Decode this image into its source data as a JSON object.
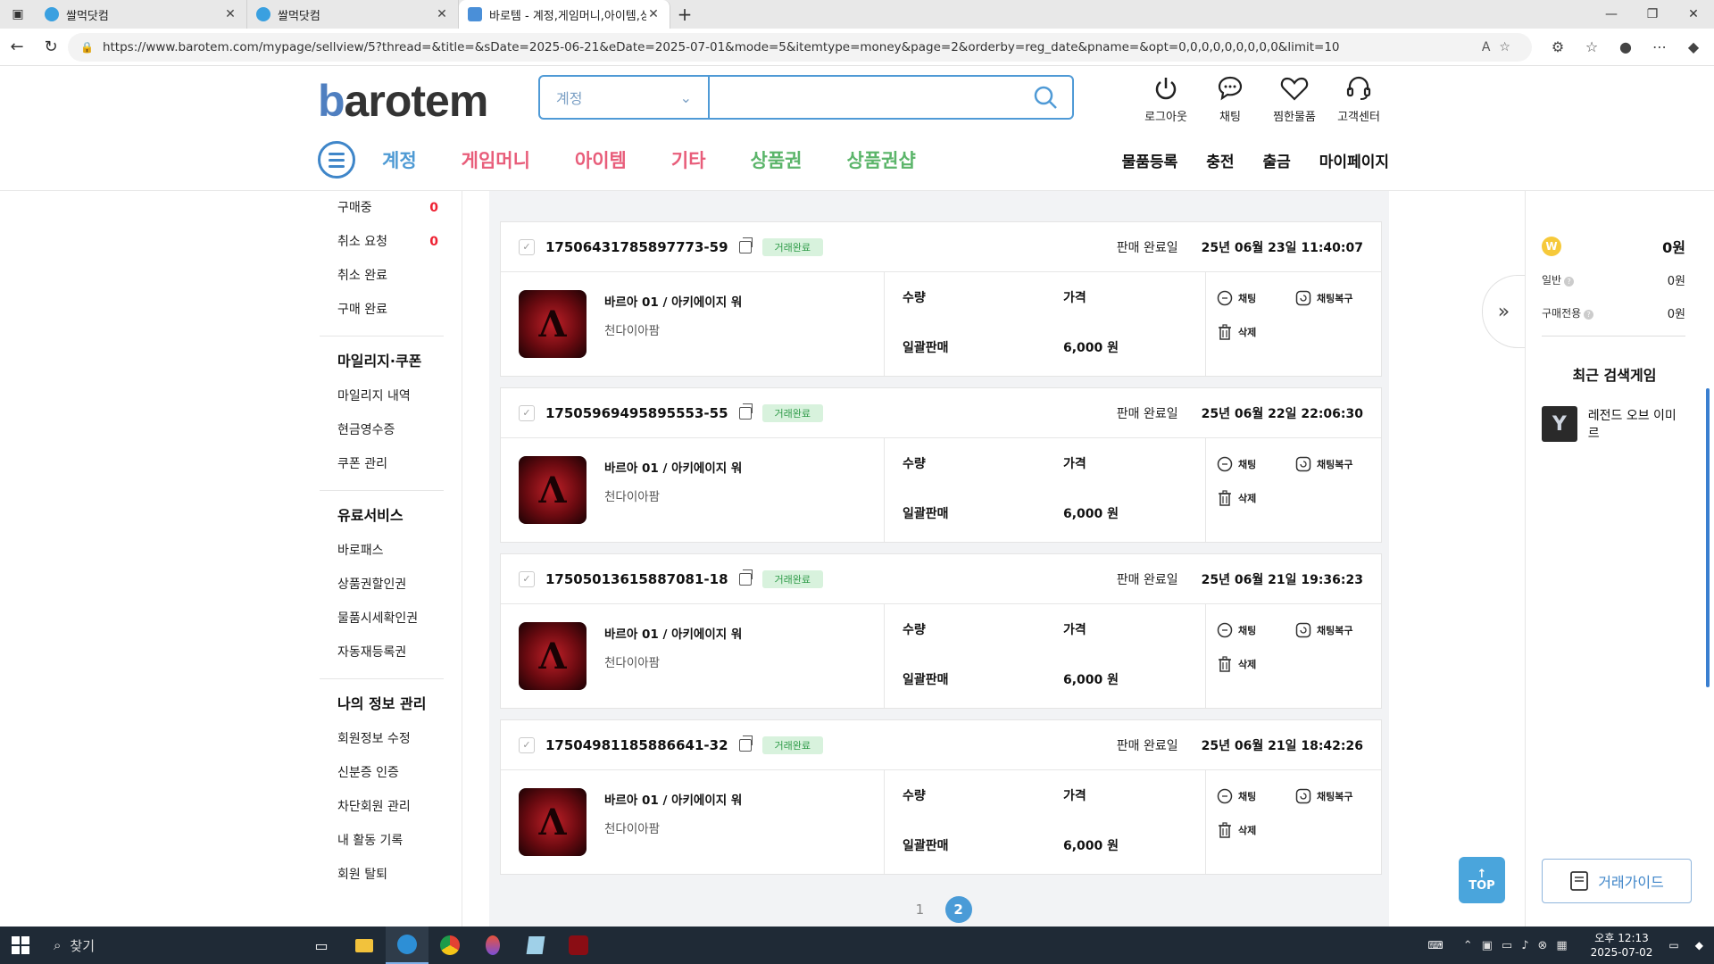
{
  "browser": {
    "tabs": [
      {
        "title": "쌀먹닷컴"
      },
      {
        "title": "쌀먹닷컴"
      },
      {
        "title": "바로템 - 계정,게임머니,아이템,상"
      }
    ],
    "url": "https://www.barotem.com/mypage/sellview/5?thread=&title=&sDate=2025-06-21&eDate=2025-07-01&mode=5&itemtype=money&page=2&orderby=reg_date&pname=&opt=0,0,0,0,0,0,0,0,0&limit=10"
  },
  "header": {
    "logo_b": "b",
    "logo_rest": "arotem",
    "search_category": "계정",
    "search_value": "",
    "icons": [
      {
        "label": "로그아웃"
      },
      {
        "label": "채팅"
      },
      {
        "label": "찜한물품"
      },
      {
        "label": "고객센터"
      }
    ]
  },
  "gnb": {
    "categories": [
      {
        "label": "계정",
        "color": "#4e9ad4"
      },
      {
        "label": "게임머니",
        "color": "#e85d7a"
      },
      {
        "label": "아이템",
        "color": "#e85d7a"
      },
      {
        "label": "기타",
        "color": "#e85d7a"
      },
      {
        "label": "상품권",
        "color": "#5bb56a"
      },
      {
        "label": "상품권샵",
        "color": "#5bb56a"
      }
    ],
    "right": [
      "물품등록",
      "충전",
      "출금",
      "마이페이지"
    ]
  },
  "sidebar": {
    "group1": [
      {
        "label": "구매중",
        "count": "0"
      },
      {
        "label": "취소 요청",
        "count": "0"
      },
      {
        "label": "취소 완료",
        "count": ""
      },
      {
        "label": "구매 완료",
        "count": ""
      }
    ],
    "group2": {
      "title": "마일리지·쿠폰",
      "items": [
        "마일리지 내역",
        "현금영수증",
        "쿠폰 관리"
      ]
    },
    "group3": {
      "title": "유료서비스",
      "items": [
        "바로패스",
        "상품권할인권",
        "물품시세확인권",
        "자동재등록권"
      ]
    },
    "group4": {
      "title": "나의 정보 관리",
      "items": [
        "회원정보 수정",
        "신분증 인증",
        "차단회원 관리",
        "내 활동 기록",
        "회원 탈퇴"
      ]
    }
  },
  "orders": [
    {
      "no": "17506431785897773-59",
      "badge": "거래완료",
      "done_label": "판매 완료일",
      "done_date": "25년 06월 23일 11:40:07",
      "title": "바르아 01 / 아키에이지 워",
      "sub": "천다이아팜",
      "qty_label": "수량",
      "price_label": "가격",
      "qty": "일괄판매",
      "price": "6,000 원",
      "chat": "채팅",
      "restore": "채팅복구",
      "delete": "삭제"
    },
    {
      "no": "17505969495895553-55",
      "badge": "거래완료",
      "done_label": "판매 완료일",
      "done_date": "25년 06월 22일 22:06:30",
      "title": "바르아 01 / 아키에이지 워",
      "sub": "천다이아팜",
      "qty_label": "수량",
      "price_label": "가격",
      "qty": "일괄판매",
      "price": "6,000 원",
      "chat": "채팅",
      "restore": "채팅복구",
      "delete": "삭제"
    },
    {
      "no": "17505013615887081-18",
      "badge": "거래완료",
      "done_label": "판매 완료일",
      "done_date": "25년 06월 21일 19:36:23",
      "title": "바르아 01 / 아키에이지 워",
      "sub": "천다이아팜",
      "qty_label": "수량",
      "price_label": "가격",
      "qty": "일괄판매",
      "price": "6,000 원",
      "chat": "채팅",
      "restore": "채팅복구",
      "delete": "삭제"
    },
    {
      "no": "17504981185886641-32",
      "badge": "거래완료",
      "done_label": "판매 완료일",
      "done_date": "25년 06월 21일 18:42:26",
      "title": "바르아 01 / 아키에이지 워",
      "sub": "천다이아팜",
      "qty_label": "수량",
      "price_label": "가격",
      "qty": "일괄판매",
      "price": "6,000 원",
      "chat": "채팅",
      "restore": "채팅복구",
      "delete": "삭제"
    }
  ],
  "pagination": {
    "pages": [
      "1",
      "2"
    ],
    "current": "2"
  },
  "right_panel": {
    "coin": "W",
    "total": "0원",
    "general_label": "일반",
    "general_value": "0원",
    "purchase_label": "구매전용",
    "purchase_value": "0원",
    "recent_title": "최근 검색게임",
    "recent_game": "레전드 오브 이미르",
    "guide_button": "거래가이드",
    "top_button": "TOP"
  },
  "taskbar": {
    "search_label": "찾기",
    "time": "오후 12:13",
    "date": "2025-07-02"
  }
}
